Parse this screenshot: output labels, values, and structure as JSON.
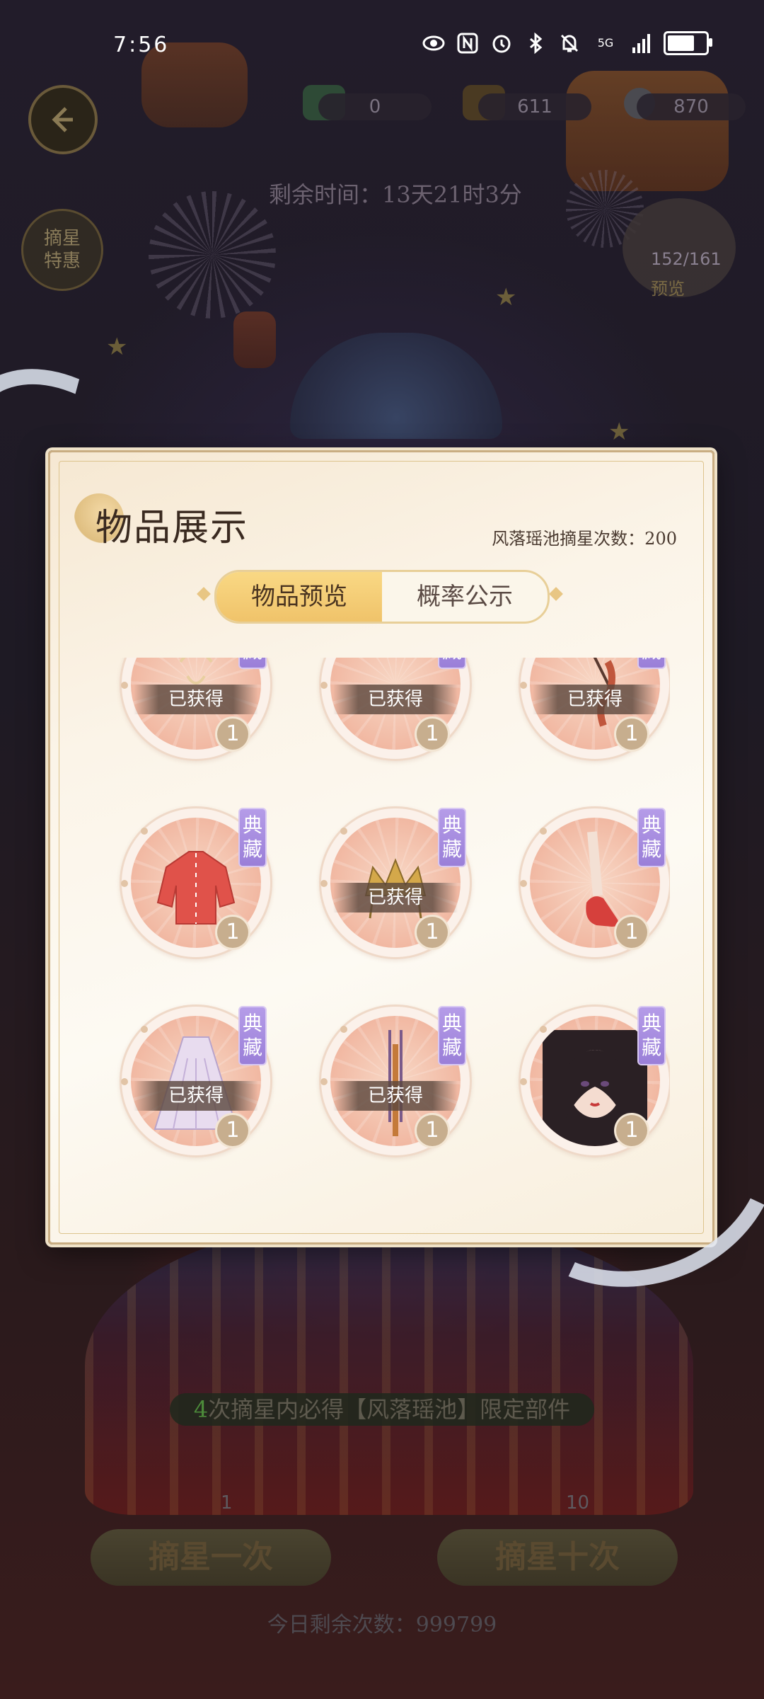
{
  "status_bar": {
    "time": "7:56",
    "network_label": "5G",
    "battery_level": 0.72,
    "icons": [
      "eye-icon",
      "nfc-icon",
      "alarm-icon",
      "bluetooth-icon",
      "mute-icon",
      "signal-icon",
      "battery-icon"
    ]
  },
  "hud": {
    "currencies": [
      {
        "icon": "book-icon",
        "value": "0"
      },
      {
        "icon": "gold-ingot-icon",
        "value": "611"
      },
      {
        "icon": "pearl-icon",
        "value": "870"
      }
    ],
    "timer": "剩余时间：13天21时3分",
    "side_badge_line1": "摘星",
    "side_badge_line2": "特惠",
    "collection_count": "152/161",
    "collection_label": "预览"
  },
  "game": {
    "guarantee_num": "4",
    "guarantee_text": "次摘星内必得【风落瑶池】限定部件",
    "pull_once": "摘星一次",
    "pull_once_cost": "1",
    "pull_ten": "摘星十次",
    "pull_ten_cost": "10",
    "remaining_today": "今日剩余次数：999799"
  },
  "modal": {
    "title": "物品展示",
    "pull_count": "风落瑶池摘星次数：200",
    "tabs": [
      {
        "label": "物品预览",
        "active": true
      },
      {
        "label": "概率公示",
        "active": false
      }
    ],
    "badge_text": "典藏",
    "owned_text": "已获得",
    "items": [
      {
        "name": "item-1",
        "owned": true,
        "qty": "1",
        "icon": "hair-accessory-icon"
      },
      {
        "name": "item-2",
        "owned": true,
        "qty": "1",
        "icon": "hairpin-icon"
      },
      {
        "name": "item-3",
        "owned": true,
        "qty": "1",
        "icon": "hand-item-icon"
      },
      {
        "name": "item-4",
        "owned": false,
        "qty": "1",
        "icon": "red-top-icon"
      },
      {
        "name": "item-5",
        "owned": true,
        "qty": "1",
        "icon": "crown-icon"
      },
      {
        "name": "item-6",
        "owned": false,
        "qty": "1",
        "icon": "red-shoes-icon"
      },
      {
        "name": "item-7",
        "owned": true,
        "qty": "1",
        "icon": "skirt-icon"
      },
      {
        "name": "item-8",
        "owned": true,
        "qty": "1",
        "icon": "earring-icon"
      },
      {
        "name": "item-9",
        "owned": false,
        "qty": "1",
        "icon": "character-portrait-icon"
      }
    ]
  }
}
